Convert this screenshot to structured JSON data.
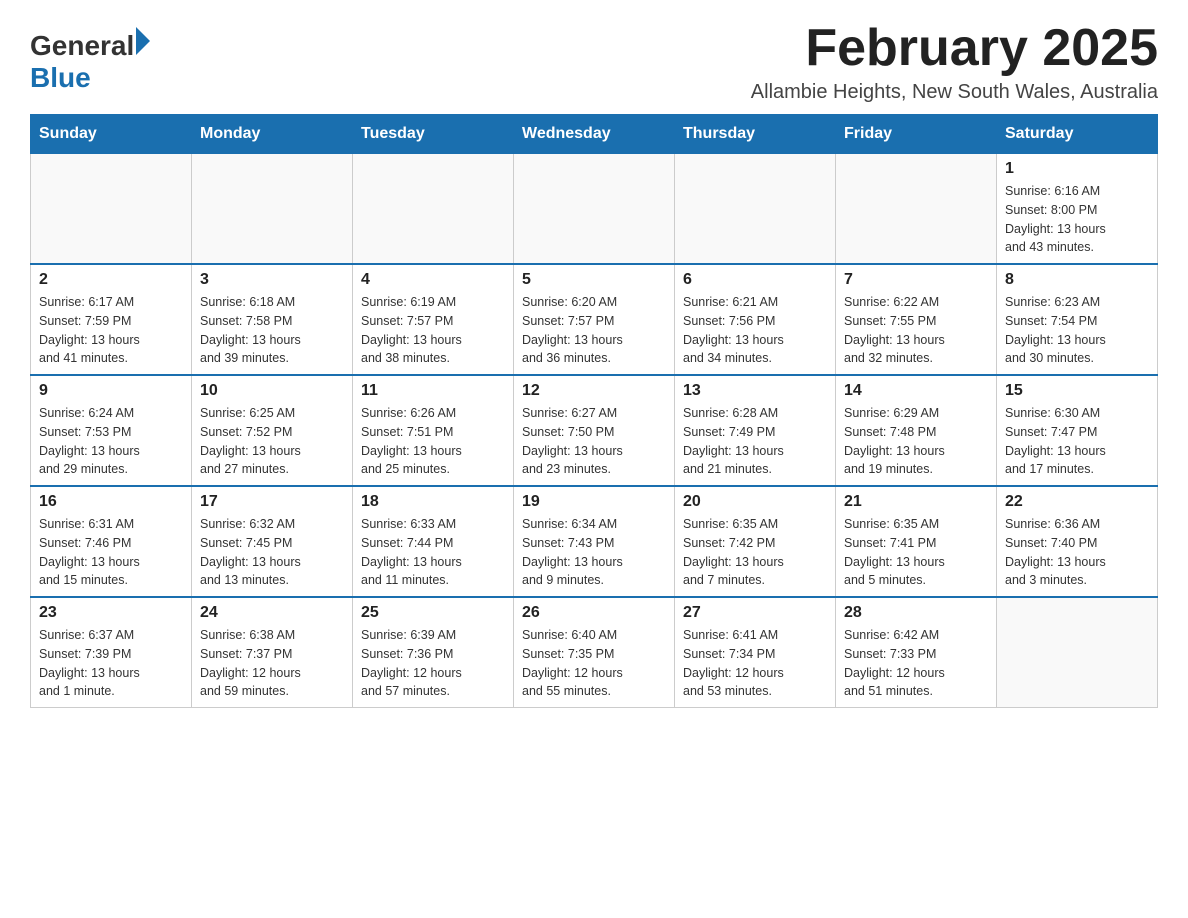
{
  "header": {
    "logo_general": "General",
    "logo_blue": "Blue",
    "month_title": "February 2025",
    "location": "Allambie Heights, New South Wales, Australia"
  },
  "days_of_week": [
    "Sunday",
    "Monday",
    "Tuesday",
    "Wednesday",
    "Thursday",
    "Friday",
    "Saturday"
  ],
  "weeks": [
    [
      {
        "day": "",
        "info": ""
      },
      {
        "day": "",
        "info": ""
      },
      {
        "day": "",
        "info": ""
      },
      {
        "day": "",
        "info": ""
      },
      {
        "day": "",
        "info": ""
      },
      {
        "day": "",
        "info": ""
      },
      {
        "day": "1",
        "info": "Sunrise: 6:16 AM\nSunset: 8:00 PM\nDaylight: 13 hours\nand 43 minutes."
      }
    ],
    [
      {
        "day": "2",
        "info": "Sunrise: 6:17 AM\nSunset: 7:59 PM\nDaylight: 13 hours\nand 41 minutes."
      },
      {
        "day": "3",
        "info": "Sunrise: 6:18 AM\nSunset: 7:58 PM\nDaylight: 13 hours\nand 39 minutes."
      },
      {
        "day": "4",
        "info": "Sunrise: 6:19 AM\nSunset: 7:57 PM\nDaylight: 13 hours\nand 38 minutes."
      },
      {
        "day": "5",
        "info": "Sunrise: 6:20 AM\nSunset: 7:57 PM\nDaylight: 13 hours\nand 36 minutes."
      },
      {
        "day": "6",
        "info": "Sunrise: 6:21 AM\nSunset: 7:56 PM\nDaylight: 13 hours\nand 34 minutes."
      },
      {
        "day": "7",
        "info": "Sunrise: 6:22 AM\nSunset: 7:55 PM\nDaylight: 13 hours\nand 32 minutes."
      },
      {
        "day": "8",
        "info": "Sunrise: 6:23 AM\nSunset: 7:54 PM\nDaylight: 13 hours\nand 30 minutes."
      }
    ],
    [
      {
        "day": "9",
        "info": "Sunrise: 6:24 AM\nSunset: 7:53 PM\nDaylight: 13 hours\nand 29 minutes."
      },
      {
        "day": "10",
        "info": "Sunrise: 6:25 AM\nSunset: 7:52 PM\nDaylight: 13 hours\nand 27 minutes."
      },
      {
        "day": "11",
        "info": "Sunrise: 6:26 AM\nSunset: 7:51 PM\nDaylight: 13 hours\nand 25 minutes."
      },
      {
        "day": "12",
        "info": "Sunrise: 6:27 AM\nSunset: 7:50 PM\nDaylight: 13 hours\nand 23 minutes."
      },
      {
        "day": "13",
        "info": "Sunrise: 6:28 AM\nSunset: 7:49 PM\nDaylight: 13 hours\nand 21 minutes."
      },
      {
        "day": "14",
        "info": "Sunrise: 6:29 AM\nSunset: 7:48 PM\nDaylight: 13 hours\nand 19 minutes."
      },
      {
        "day": "15",
        "info": "Sunrise: 6:30 AM\nSunset: 7:47 PM\nDaylight: 13 hours\nand 17 minutes."
      }
    ],
    [
      {
        "day": "16",
        "info": "Sunrise: 6:31 AM\nSunset: 7:46 PM\nDaylight: 13 hours\nand 15 minutes."
      },
      {
        "day": "17",
        "info": "Sunrise: 6:32 AM\nSunset: 7:45 PM\nDaylight: 13 hours\nand 13 minutes."
      },
      {
        "day": "18",
        "info": "Sunrise: 6:33 AM\nSunset: 7:44 PM\nDaylight: 13 hours\nand 11 minutes."
      },
      {
        "day": "19",
        "info": "Sunrise: 6:34 AM\nSunset: 7:43 PM\nDaylight: 13 hours\nand 9 minutes."
      },
      {
        "day": "20",
        "info": "Sunrise: 6:35 AM\nSunset: 7:42 PM\nDaylight: 13 hours\nand 7 minutes."
      },
      {
        "day": "21",
        "info": "Sunrise: 6:35 AM\nSunset: 7:41 PM\nDaylight: 13 hours\nand 5 minutes."
      },
      {
        "day": "22",
        "info": "Sunrise: 6:36 AM\nSunset: 7:40 PM\nDaylight: 13 hours\nand 3 minutes."
      }
    ],
    [
      {
        "day": "23",
        "info": "Sunrise: 6:37 AM\nSunset: 7:39 PM\nDaylight: 13 hours\nand 1 minute."
      },
      {
        "day": "24",
        "info": "Sunrise: 6:38 AM\nSunset: 7:37 PM\nDaylight: 12 hours\nand 59 minutes."
      },
      {
        "day": "25",
        "info": "Sunrise: 6:39 AM\nSunset: 7:36 PM\nDaylight: 12 hours\nand 57 minutes."
      },
      {
        "day": "26",
        "info": "Sunrise: 6:40 AM\nSunset: 7:35 PM\nDaylight: 12 hours\nand 55 minutes."
      },
      {
        "day": "27",
        "info": "Sunrise: 6:41 AM\nSunset: 7:34 PM\nDaylight: 12 hours\nand 53 minutes."
      },
      {
        "day": "28",
        "info": "Sunrise: 6:42 AM\nSunset: 7:33 PM\nDaylight: 12 hours\nand 51 minutes."
      },
      {
        "day": "",
        "info": ""
      }
    ]
  ]
}
